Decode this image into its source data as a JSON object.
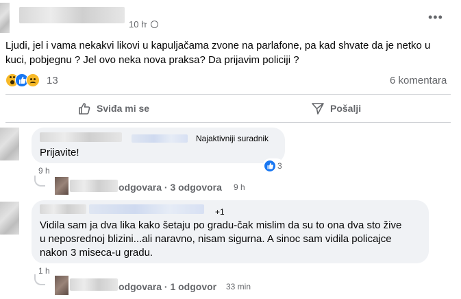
{
  "post": {
    "timestamp": "10 h",
    "text": "Ljudi, jel i vama nekakvi likovi u kapuljačama zvone na parlafone, pa kad shvate da je netko u kuci, pobjegnu ? Jel ovo neka nova praksa? Da prijavim policiji ?",
    "reaction_count": "13",
    "comments_count": "6 komentara"
  },
  "actions": {
    "like_label": "Sviđa mi se",
    "share_label": "Pošalji"
  },
  "comments": [
    {
      "badge": "Najaktivniji suradnik",
      "text": "Prijavite!",
      "time": "9 h",
      "reaction_count": "3",
      "reply_summary": "odgovara · 3 odgovora",
      "reply_time": "9 h"
    },
    {
      "badge": "+1",
      "text": "Vidila sam ja dva lika kako šetaju po gradu-čak mislim da su to ona dva sto žive u neposrednoj blizini...ali naravno, nisam sigurna. A sinoc sam vidila policajce nakon 3 miseca-u gradu.",
      "time": "1 h",
      "reply_summary": "odgovara · 1 odgovor",
      "reply_time": "33 min"
    }
  ],
  "colors": {
    "accent_blue": "#1877f2",
    "bubble_bg": "#f0f2f5",
    "muted_text": "#65676b"
  }
}
